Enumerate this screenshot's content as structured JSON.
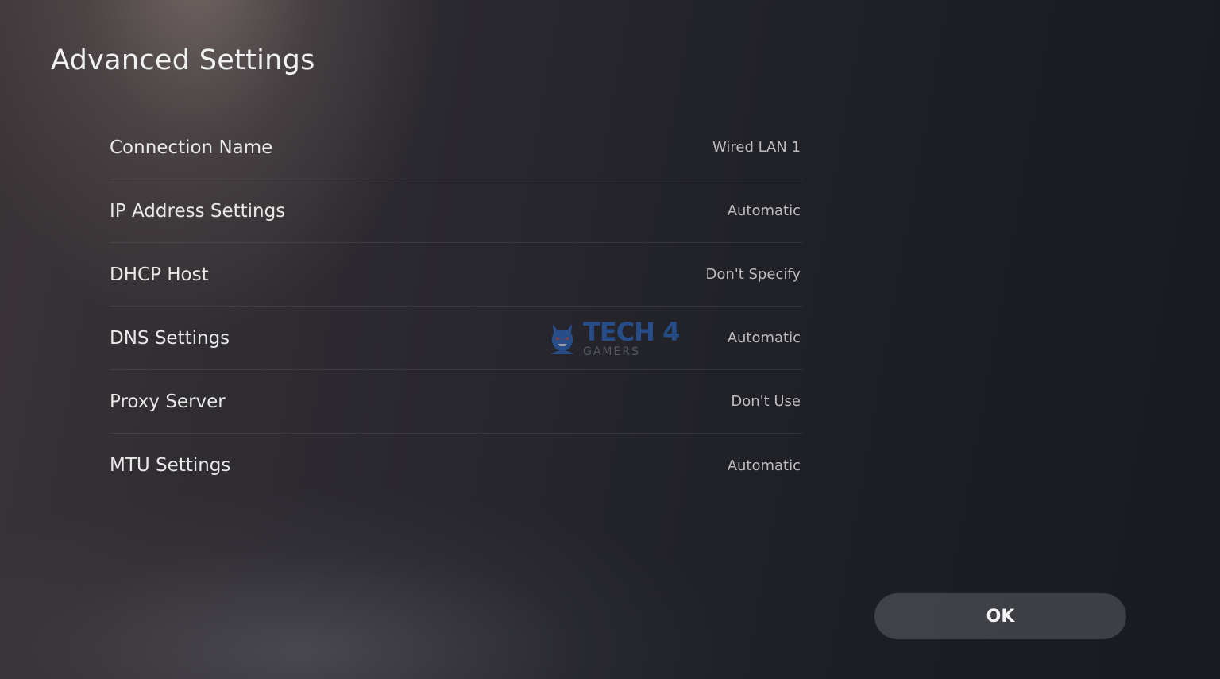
{
  "header": {
    "title": "Advanced Settings"
  },
  "settings": [
    {
      "label": "Connection Name",
      "value": "Wired LAN 1"
    },
    {
      "label": "IP Address Settings",
      "value": "Automatic"
    },
    {
      "label": "DHCP Host",
      "value": "Don't Specify"
    },
    {
      "label": "DNS Settings",
      "value": "Automatic"
    },
    {
      "label": "Proxy Server",
      "value": "Don't Use"
    },
    {
      "label": "MTU Settings",
      "value": "Automatic"
    }
  ],
  "watermark": {
    "main": "TECH 4",
    "sub": "GAMERS",
    "icon": "mascot-icon",
    "color": "#2a6fd6"
  },
  "footer": {
    "ok_label": "OK"
  }
}
